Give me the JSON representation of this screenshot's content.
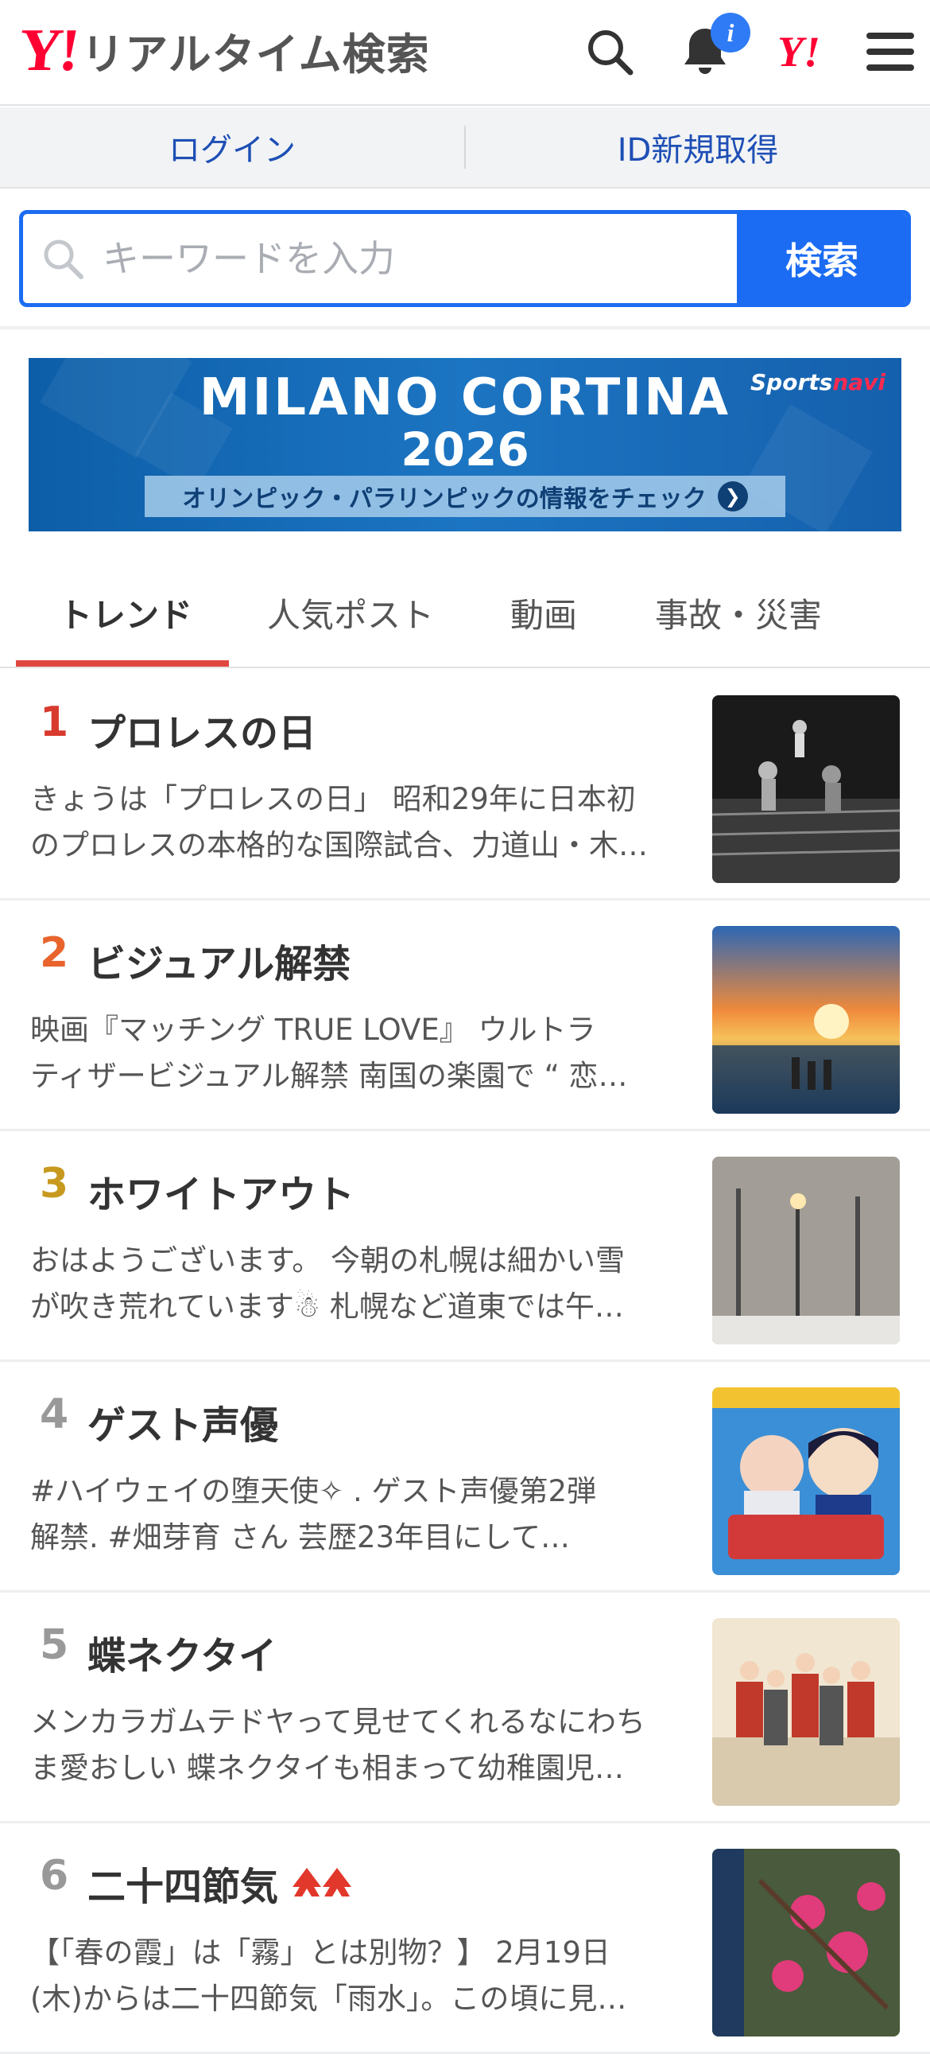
{
  "header": {
    "logo_mark": "Y!",
    "logo_text": "リアルタイム検索",
    "notification_badge": "i",
    "yahoo_mark": "Y!"
  },
  "auth": {
    "login": "ログイン",
    "signup": "ID新規取得"
  },
  "search": {
    "placeholder": "キーワードを入力",
    "button": "検索"
  },
  "banner": {
    "line1": "MILANO CORTINA",
    "line2": "2026",
    "strip": "オリンピック・パラリンピックの情報をチェック",
    "brand_a": "Sports",
    "brand_b": "navi"
  },
  "tabs": [
    {
      "label": "トレンド",
      "active": true
    },
    {
      "label": "人気ポスト",
      "active": false
    },
    {
      "label": "動画",
      "active": false
    },
    {
      "label": "事故・災害",
      "active": false
    }
  ],
  "trends": [
    {
      "rank": "1",
      "rank_color": "#d83a2e",
      "title": "プロレスの日",
      "line1": "きょうは「プロレスの日」 昭和29年に日本初",
      "line2": "のプロレスの本格的な国際試合、力道山・木…",
      "thumb": "wrestling-photo"
    },
    {
      "rank": "2",
      "rank_color": "#e8642c",
      "title": "ビジュアル解禁",
      "line1": "映画『マッチング TRUE LOVE』 ウルトラ",
      "line2": "ティザービジュアル解禁 南国の楽園で “ 恋…",
      "thumb": "movie-poster"
    },
    {
      "rank": "3",
      "rank_color": "#c79a1f",
      "title": "ホワイトアウト",
      "line1": "おはようございます。 今朝の札幌は細かい雪",
      "line2": "が吹き荒れています☃ 札幌など道東では午…",
      "thumb": "snow-street-photo"
    },
    {
      "rank": "4",
      "rank_color": "#999999",
      "title": "ゲスト声優",
      "line1": "#ハイウェイの堕天使✧ .  ゲスト声優第2弾",
      "line2": "解禁. #畑芽育 さん 芸歴23年目にして…",
      "thumb": "anime-announcement"
    },
    {
      "rank": "5",
      "rank_color": "#999999",
      "title": "蝶ネクタイ",
      "line1": "メンカラガムテドヤって見せてくれるなにわち",
      "line2": "ま愛おしい 蝶ネクタイも相まって幼稚園児…",
      "thumb": "group-photo"
    },
    {
      "rank": "6",
      "rank_color": "#999999",
      "title": "二十四節気",
      "line1": "【「春の霞」は「霧」とは別物？】 2月19日",
      "line2": "(木)からは二十四節気「雨水」。この頃に見…",
      "thumb": "flower-photo",
      "rising": true
    }
  ]
}
